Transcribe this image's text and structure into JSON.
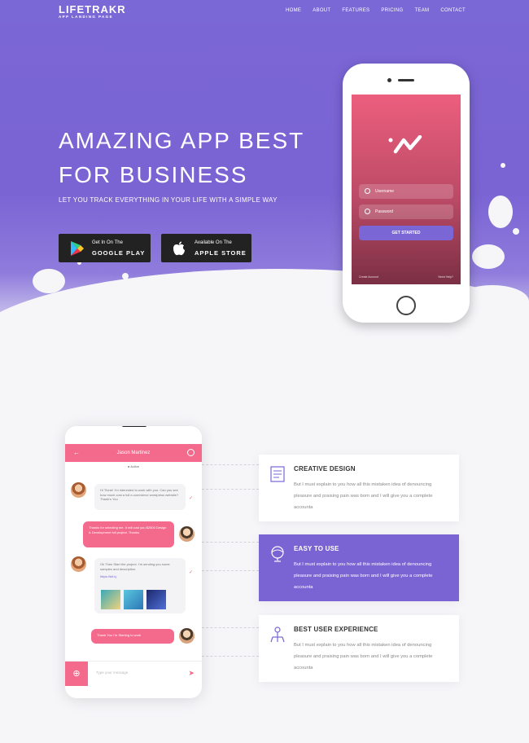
{
  "nav": {
    "logo": "LIFETRAKR",
    "logo_sub": "APP LANDING PAGE",
    "menu": [
      "HOME",
      "ABOUT",
      "FEATURES",
      "PRICING",
      "TEAM",
      "CONTACT"
    ]
  },
  "hero": {
    "title_line1": "AMAZING APP BEST",
    "title_line2": "FOR BUSINESS",
    "tagline": "LET YOU TRACK EVERYTHING IN YOUR LIFE WITH A SIMPLE WAY",
    "google": {
      "line1": "Get In On The",
      "line2": "GOOGLE PLAY"
    },
    "apple": {
      "line1": "Available On The",
      "line2": "APPLE STORE"
    }
  },
  "phone_login": {
    "username_placeholder": "Username",
    "password_placeholder": "Password",
    "button": "GET STARTED",
    "create_account": "Create Account",
    "need_help": "Need Help?"
  },
  "chat": {
    "header_title": "Jason Martinez",
    "status": "Active",
    "messages": [
      "Hi There! I'm interested to work with you. Can you see how much cost a full e-commerce wordpress website? Thank's You",
      "Thanks for selecting me. It will cost you $2500 Design & Development full project. Thanks",
      "Ok Then Start the project. I'm sending you some samples and description.",
      "Thank You I'm Starting to work"
    ],
    "link": "https://bit.ly",
    "input_placeholder": "Type your message"
  },
  "features": [
    {
      "icon": "document-icon",
      "title": "CREATIVE DESIGN",
      "text": "But I must explain to you how all this mistaken idea of denouncing pleasure and praising pain was born and I will give you a complete accounta"
    },
    {
      "icon": "globe-icon",
      "title": "EASY TO USE",
      "text": "But I must explain to you how all this mistaken idea of denouncing pleasure and praising pain was born and I will give you a complete accounta"
    },
    {
      "icon": "network-icon",
      "title": "BEST USER EXPERIENCE",
      "text": "But I must explain to you how all this mistaken idea of denouncing pleasure and praising pain was born and I will give you a complete accounta"
    }
  ],
  "colors": {
    "primary": "#7a64d4",
    "accent": "#f36a8c",
    "dark": "#222222"
  }
}
